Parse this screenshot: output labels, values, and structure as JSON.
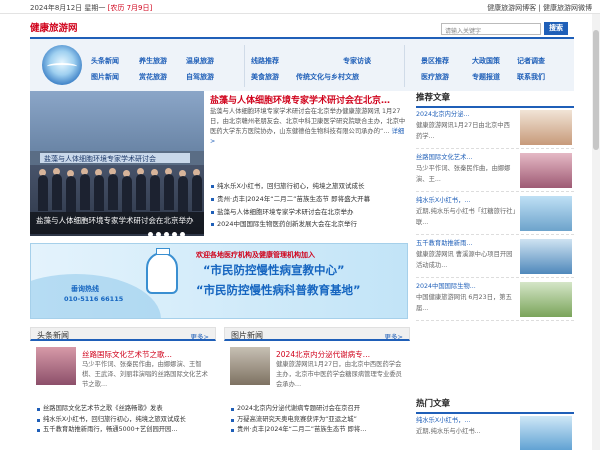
{
  "topbar": {
    "date": "2024年8月12日 星期一",
    "lunar": "[农历 7月9日]",
    "links": "健康旅游网博客 | 健康旅游网微博"
  },
  "site": {
    "name": "健康旅游网"
  },
  "search": {
    "placeholder": "请输入关键字",
    "button": "搜索"
  },
  "nav": {
    "row1": [
      "头条新闻",
      "养生旅游",
      "温泉旅游",
      "线路推荐",
      "专家访谈",
      "景区推荐",
      "大政国策",
      "记者调查"
    ],
    "row2": [
      "图片新闻",
      "赏花旅游",
      "自驾旅游",
      "美食旅游",
      "传统文化与乡村文旅",
      "医疗旅游",
      "专题报道",
      "联系我们"
    ]
  },
  "slider": {
    "banner_text": "盐藻与人体细胞环境专家学术研讨会",
    "caption": "盐藻与人体细胞环境专家学术研讨会在北京举办",
    "dots": 5
  },
  "feature": {
    "headline": "盐藻与人体细胞环境专家学术研讨会在北京…",
    "summary": "盐藻与人体细胞环境专家学术研讨会在北京举办健康旅游网讯 1月27日，由北京赣州老朋友会、北京中科卫康医学研究院联合主办，北京中医药大学东方医院协办，山东健德伯生物科技有限公司承办的“…",
    "more": "详细>"
  },
  "news_list": [
    "纯水乐X小红书，回归旅行初心，纯境之旅双试成长",
    "贵州·贞丰|2024年“二月二”苗族生态节 即将盛大开幕",
    "盐藻与人体细胞环境专家学术研讨会在北京举办",
    "2024中国国际生物医药创新发展大会在北京举行"
  ],
  "ad": {
    "top": "欢迎各地医疗机构及健康管理机构加入",
    "line1": "“市民防控慢性病宣教中心”",
    "line2": "“市民防控慢性病科普教育基地”",
    "hotline_label": "垂询热线",
    "hotline": "010-5116 66115"
  },
  "panels": {
    "headline_news": {
      "title": "头条新闻",
      "more": "更多>",
      "lead_title": "丝路国际文化艺术节之歌…",
      "lead_desc": "马少平作词、张秦民作曲，由娜娜演、王智棋、王武泽、刘丽菲演唱的丝路国际文化艺术节之歌…",
      "items": [
        "丝路国际文化艺术节之歌《丝路畅歌》发表",
        "纯水乐X小红书，回归旅行初心，纯境之旅双试成长",
        "五千教育助推新雨行，畅通5000+艺创园开园…"
      ]
    },
    "photo_news": {
      "title": "图片新闻",
      "more": "更多>",
      "lead_title": "2024北京内分泌代谢病专…",
      "lead_desc": "健康旅游网讯1月27日，由北京中西医药学会主办，北京市中医药学会糖尿病管理专业委员会承办…",
      "items": [
        "2024北京内分泌代谢病专题研讨会在京召开",
        "万疑高流研究天奥电竞赛获评为“亚运之城”",
        "贵州·贞丰|2024年“二月二”苗族生态节 即将…"
      ]
    }
  },
  "sidebar": {
    "recommended_title": "推荐文章",
    "recommended": [
      {
        "highlight": "2024北京内分泌...",
        "text": "健康旅游网讯1月27日由北京中西药学..."
      },
      {
        "highlight": "丝路国际文化艺术...",
        "text": "马少平作词、张秦民作曲，由娜娜演、王..."
      },
      {
        "highlight": "纯水乐X小红书，...",
        "text": "近期,纯水乐与小红书「红糖旅行社」联..."
      },
      {
        "highlight": "五千教育助推新雨...",
        "text": "健康旅游网讯 曹溪源中心项目开园活动成功..."
      },
      {
        "highlight": "2024中国国际生物...",
        "text": "中国健康旅游网讯 6月23日，第五届..."
      }
    ],
    "hot_title": "热门文章",
    "hot": [
      {
        "highlight": "纯水乐X小红书，...",
        "text": "近期,纯水乐与小红书..."
      }
    ]
  },
  "colors": {
    "accent": "#1f5fb8",
    "headline": "#d0021b",
    "nav_bg": "#eef3f9"
  }
}
